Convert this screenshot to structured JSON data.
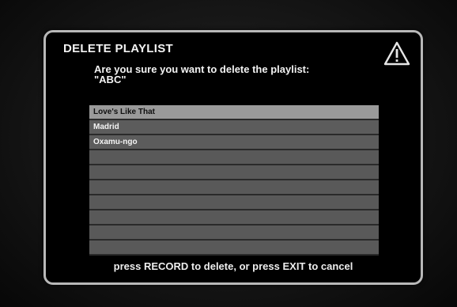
{
  "dialog": {
    "title": "DELETE PLAYLIST",
    "question_line1": "Are you sure you want to delete the playlist:",
    "question_line2": "\"ABC\"",
    "instructions": "press RECORD to delete, or press EXIT to cancel"
  },
  "playlist": {
    "selected_index": 0,
    "songs": [
      "Love's Like That",
      "Madrid",
      "Oxamu-ngo",
      "",
      "",
      "",
      "",
      "",
      "",
      ""
    ]
  },
  "icons": {
    "warning": "warning-triangle-icon"
  },
  "colors": {
    "background": "#000000",
    "dialog_border": "#b8b8b8",
    "text": "#f2f2f2",
    "list_row": "#5c5c5c",
    "list_row_selected": "#9a9a9a"
  }
}
